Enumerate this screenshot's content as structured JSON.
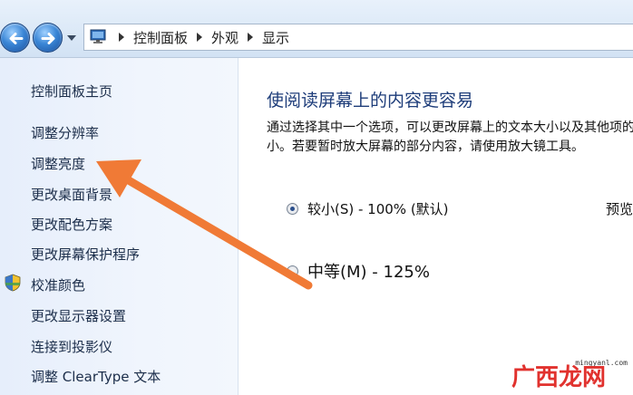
{
  "breadcrumb": [
    "控制面板",
    "外观",
    "显示"
  ],
  "sidebar": {
    "home": "控制面板主页",
    "links": [
      "调整分辨率",
      "调整亮度",
      "更改桌面背景",
      "更改配色方案",
      "更改屏幕保护程序",
      "校准颜色",
      "更改显示器设置",
      "连接到投影仪",
      "调整 ClearType 文本"
    ]
  },
  "main": {
    "heading": "使阅读屏幕上的内容更容易",
    "description": "通过选择其中一个选项，可以更改屏幕上的文本大小以及其他项的大小。若要暂时放大屏幕的部分内容，请使用放大镜工具。",
    "options": [
      {
        "label": "较小(S) - 100% (默认)",
        "selected": true
      },
      {
        "label": "中等(M) - 125%",
        "selected": false
      }
    ],
    "preview_label": "预览"
  },
  "watermark": {
    "domain": "mingyanl.com",
    "brand": "广西龙网"
  },
  "colors": {
    "arrow": "#f07a36",
    "link": "#1c2e4a",
    "heading": "#1e3d7a",
    "watermark": "#e1322e"
  },
  "icons": [
    "back-arrow-icon",
    "forward-arrow-icon",
    "computer-icon",
    "shield-icon"
  ]
}
